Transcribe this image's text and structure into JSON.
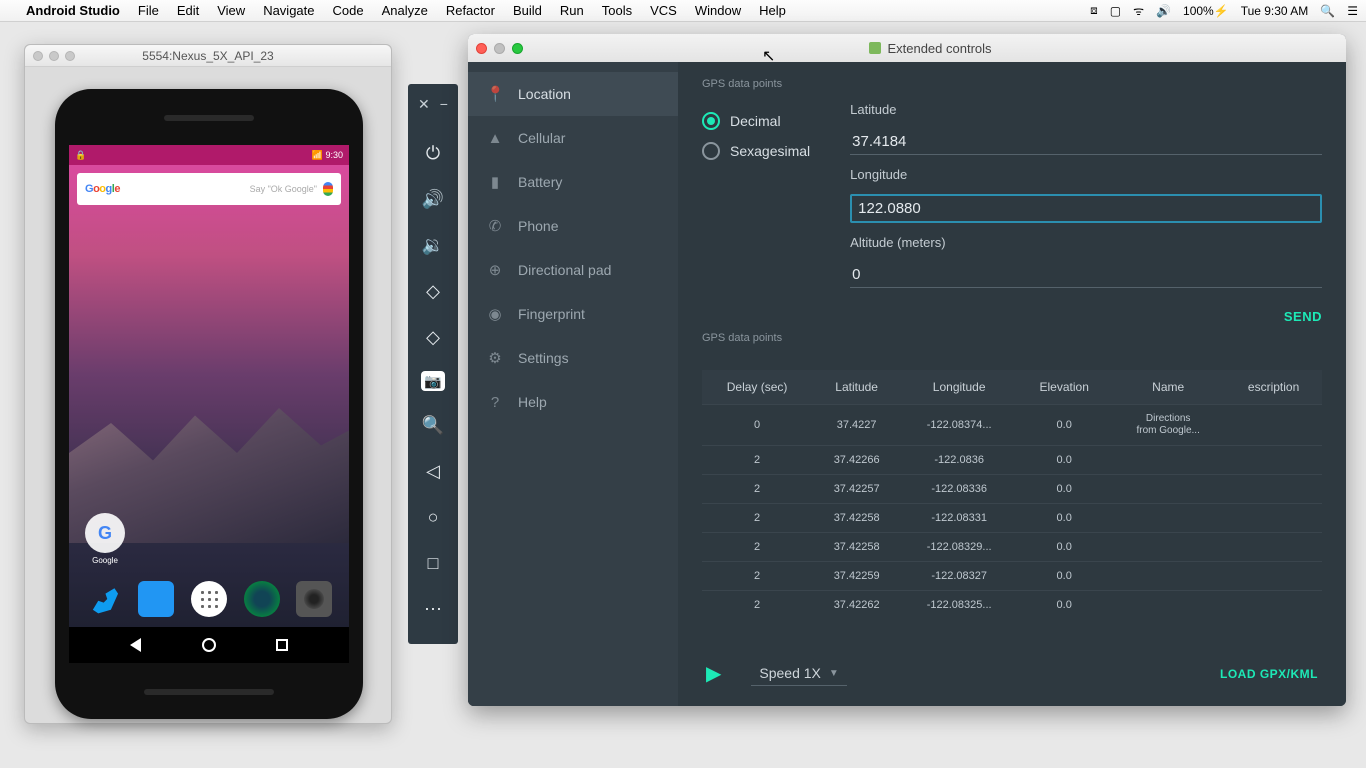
{
  "menubar": {
    "app": "Android Studio",
    "items": [
      "File",
      "Edit",
      "View",
      "Navigate",
      "Code",
      "Analyze",
      "Refactor",
      "Build",
      "Run",
      "Tools",
      "VCS",
      "Window",
      "Help"
    ],
    "battery": "100%",
    "clock": "Tue 9:30 AM"
  },
  "emulator": {
    "title": "5554:Nexus_5X_API_23",
    "status_time": "9:30",
    "search_hint": "Say \"Ok Google\"",
    "folder_label": "Google"
  },
  "ext": {
    "title": "Extended controls",
    "sidebar": [
      {
        "icon": "📍",
        "label": "Location",
        "active": true
      },
      {
        "icon": "▲",
        "label": "Cellular"
      },
      {
        "icon": "▮",
        "label": "Battery"
      },
      {
        "icon": "✆",
        "label": "Phone"
      },
      {
        "icon": "⊕",
        "label": "Directional pad"
      },
      {
        "icon": "◉",
        "label": "Fingerprint"
      },
      {
        "icon": "⚙",
        "label": "Settings"
      },
      {
        "icon": "?",
        "label": "Help"
      }
    ],
    "section1_label": "GPS data points",
    "radio_decimal": "Decimal",
    "radio_sexagesimal": "Sexagesimal",
    "lat_label": "Latitude",
    "lat_value": "37.4184",
    "lon_label": "Longitude",
    "lon_value": "122.0880",
    "alt_label": "Altitude (meters)",
    "alt_value": "0",
    "send_label": "SEND",
    "section2_label": "GPS data points",
    "table_headers": [
      "Delay (sec)",
      "Latitude",
      "Longitude",
      "Elevation",
      "Name",
      "escription"
    ],
    "rows": [
      {
        "delay": "0",
        "lat": "37.4227",
        "lon": "-122.08374...",
        "elev": "0.0",
        "name": "Directions\nfrom Google...",
        "desc": ""
      },
      {
        "delay": "2",
        "lat": "37.42266",
        "lon": "-122.0836",
        "elev": "0.0",
        "name": "",
        "desc": ""
      },
      {
        "delay": "2",
        "lat": "37.42257",
        "lon": "-122.08336",
        "elev": "0.0",
        "name": "",
        "desc": ""
      },
      {
        "delay": "2",
        "lat": "37.42258",
        "lon": "-122.08331",
        "elev": "0.0",
        "name": "",
        "desc": ""
      },
      {
        "delay": "2",
        "lat": "37.42258",
        "lon": "-122.08329...",
        "elev": "0.0",
        "name": "",
        "desc": ""
      },
      {
        "delay": "2",
        "lat": "37.42259",
        "lon": "-122.08327",
        "elev": "0.0",
        "name": "",
        "desc": ""
      },
      {
        "delay": "2",
        "lat": "37.42262",
        "lon": "-122.08325...",
        "elev": "0.0",
        "name": "",
        "desc": ""
      }
    ],
    "speed_label": "Speed 1X",
    "load_label": "LOAD GPX/KML"
  }
}
